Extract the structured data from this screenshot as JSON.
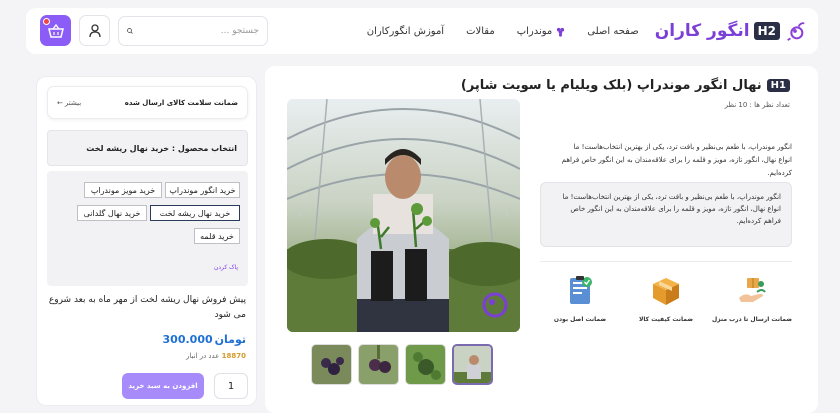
{
  "header": {
    "logo_tag": "H2",
    "logo_text": "انگور کاران",
    "nav": [
      {
        "label": "صفحه اصلی"
      },
      {
        "label": "موندراپ"
      },
      {
        "label": "مقالات"
      },
      {
        "label": "آموزش انگورکاران"
      }
    ],
    "search_placeholder": "جستجو ..."
  },
  "product": {
    "title_tag": "H1",
    "title": "نهال انگور موندراپ (بلک ویلیام یا سویت شاپر)",
    "rating": "تعداد نظر ها : 10 نظر",
    "description": "انگور موندراپ، با طعم بی‌نظیر و بافت ترد، یکی از بهترین انتخاب‌هاست! ما انواع نهال، انگور تازه، مویز و قلمه را برای علاقه‌مندان به این انگور خاص فراهم کرده‌ایم.",
    "description_box": "انگور موندراپ، با طعم بی‌نظیر و بافت ترد، یکی از بهترین انتخاب‌هاست! ما انواع نهال، انگور تازه، مویز و قلمه را برای علاقه‌مندان به این انگور خاص فراهم کرده‌ایم.",
    "features": [
      {
        "label": "ضمانت ارسال تا درب منزل",
        "icon": "delivery-icon"
      },
      {
        "label": "ضمانت کیفیت کالا",
        "icon": "box-icon"
      },
      {
        "label": "ضمانت اصل بودن",
        "icon": "certificate-icon"
      }
    ]
  },
  "sidebar": {
    "guarantee_title": "ضمانت سلامت کالای ارسال شده",
    "guarantee_more": "بیشتر",
    "select_label": "انتخاب محصول : خرید نهال ریشه لخت",
    "options": [
      {
        "label": "خرید انگور موندراپ"
      },
      {
        "label": "خرید مویز موندراپ"
      },
      {
        "label": "خرید نهال ریشه لخت"
      },
      {
        "label": "خرید نهال گلدانی"
      },
      {
        "label": "خرید قلمه"
      }
    ],
    "clear_label": "پاک کردن",
    "presale": "پیش فروش نهال ریشه لخت از مهر ماه به بعد شروع می شود",
    "price_value": "300.000",
    "price_unit": "تومان",
    "stock_count": "18870",
    "stock_text": "عدد در انبار",
    "add_to_cart": "افزودن به سبد خرید",
    "quantity": "1"
  },
  "colors": {
    "accent": "#8b5cf6",
    "brand": "#7b3fd6",
    "price": "#1d6fd6"
  }
}
